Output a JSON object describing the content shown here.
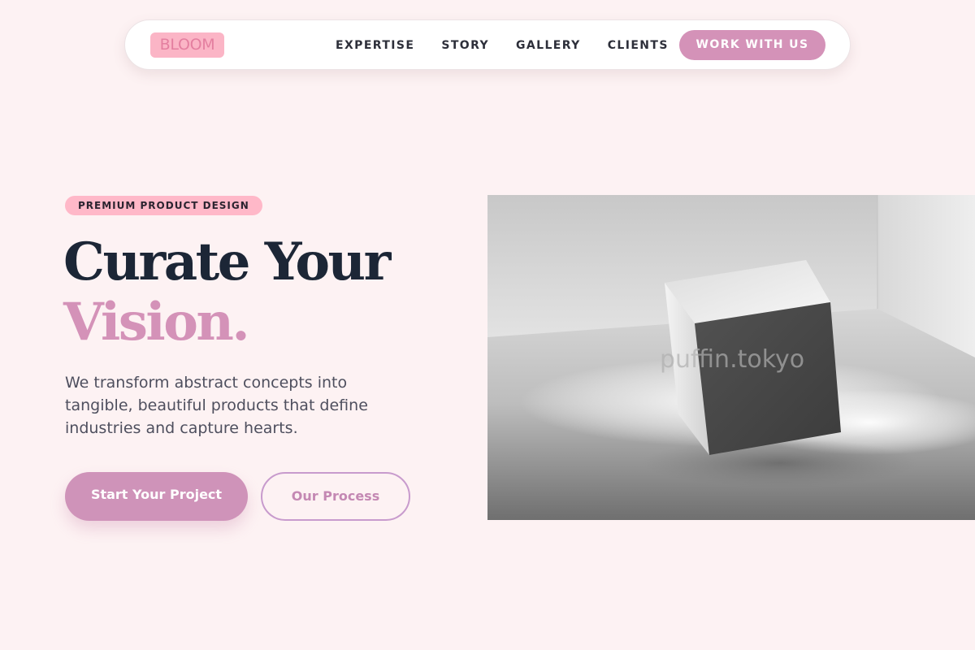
{
  "brand": {
    "logo_text": "BLOOM"
  },
  "nav": {
    "links": [
      "EXPERTISE",
      "STORY",
      "GALLERY",
      "CLIENTS"
    ],
    "cta_label": "WORK WITH US"
  },
  "hero": {
    "badge": "PREMIUM PRODUCT DESIGN",
    "headline_line1": "Curate Your",
    "headline_line2": "Vision.",
    "description": "We transform abstract concepts into tangible, beautiful products that define industries and capture hearts.",
    "primary_button": "Start Your Project",
    "secondary_button": "Our Process",
    "image_watermark": "puffin.tokyo",
    "image_description": "grayscale 3D cube resting in a minimal room with soft light"
  },
  "colors": {
    "background": "#fdf2f3",
    "accent": "#d492b8",
    "badge": "#ffb8c8",
    "heading": "#1c2636"
  }
}
